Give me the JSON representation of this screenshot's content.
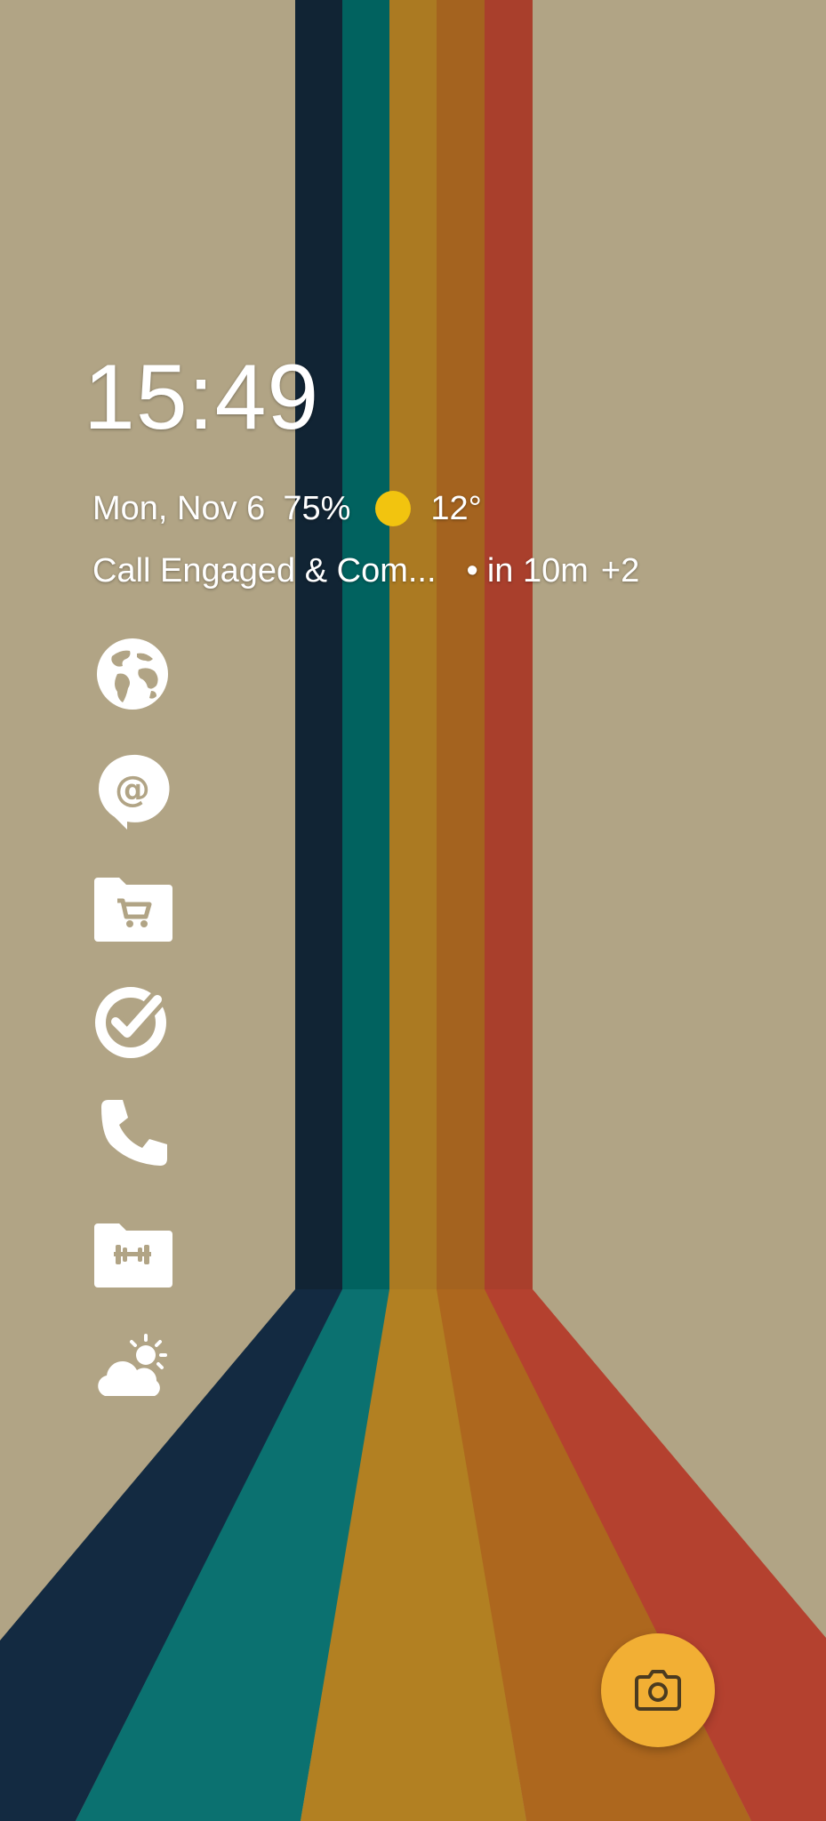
{
  "colors": {
    "background": "#b1a485",
    "stripe_navy": "#112434",
    "stripe_teal": "#0b6b6a",
    "stripe_mustard": "#b28022",
    "stripe_orange": "#ad671e",
    "stripe_red": "#b4412f",
    "weather_sun": "#f2c40f",
    "camera_button": "#f2af34",
    "icon_color": "#ffffff"
  },
  "clock": {
    "time": "15:49"
  },
  "glance": {
    "date": "Mon, Nov 6",
    "battery": "75%",
    "weather_icon": "sun-icon",
    "temperature": "12°"
  },
  "event": {
    "title": "Call Engaged & Com...",
    "bullet": "•",
    "when": "in 10m",
    "more": "+2"
  },
  "apps": [
    {
      "name": "globe-icon"
    },
    {
      "name": "at-chat-icon"
    },
    {
      "name": "shopping-folder-icon"
    },
    {
      "name": "task-check-icon"
    },
    {
      "name": "phone-icon"
    },
    {
      "name": "fitness-folder-icon"
    },
    {
      "name": "weather-cloud-sun-icon"
    }
  ],
  "camera_button": {
    "icon": "camera-icon"
  }
}
